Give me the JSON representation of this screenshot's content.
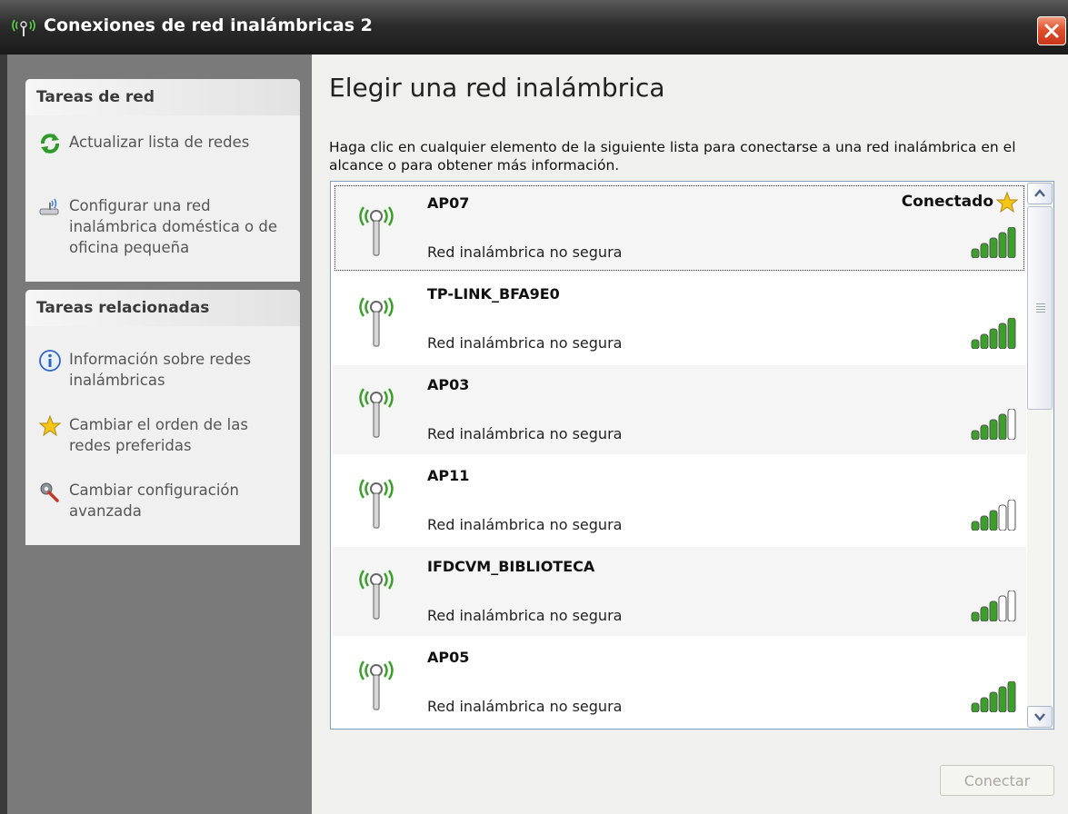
{
  "window": {
    "title": "Conexiones de red inalámbricas 2",
    "close_icon": "close-icon"
  },
  "sidebar": {
    "network_tasks": {
      "header": "Tareas de red",
      "items": [
        {
          "label": "Actualizar lista de redes",
          "icon": "refresh-icon"
        },
        {
          "label": "Configurar una red inalámbrica doméstica o de oficina pequeña",
          "icon": "wireless-setup-icon"
        }
      ]
    },
    "related_tasks": {
      "header": "Tareas relacionadas",
      "items": [
        {
          "label": "Información sobre redes inalámbricas",
          "icon": "info-icon"
        },
        {
          "label": "Cambiar el orden de las redes preferidas",
          "icon": "star-icon"
        },
        {
          "label": "Cambiar configuración avanzada",
          "icon": "settings-icon"
        }
      ]
    }
  },
  "main": {
    "heading": "Elegir una red inalámbrica",
    "description": "Haga clic en cualquier elemento de la siguiente lista para conectarse a una red inalámbrica en el alcance o para obtener más información.",
    "networks": [
      {
        "name": "AP07",
        "security": "Red inalámbrica no segura",
        "status": "Conectado",
        "signal_bars": 5
      },
      {
        "name": "TP-LINK_BFA9E0",
        "security": "Red inalámbrica no segura",
        "status": "",
        "signal_bars": 5
      },
      {
        "name": "AP03",
        "security": "Red inalámbrica no segura",
        "status": "",
        "signal_bars": 4
      },
      {
        "name": "AP11",
        "security": "Red inalámbrica no segura",
        "status": "",
        "signal_bars": 3
      },
      {
        "name": "IFDCVM_BIBLIOTECA",
        "security": "Red inalámbrica no segura",
        "status": "",
        "signal_bars": 3
      },
      {
        "name": "AP05",
        "security": "Red inalámbrica no segura",
        "status": "",
        "signal_bars": 5
      }
    ],
    "connect_button": "Conectar"
  },
  "colors": {
    "signal_green": "#3aa02a",
    "signal_empty": "#ffffff",
    "accent_star": "#f5c518"
  }
}
